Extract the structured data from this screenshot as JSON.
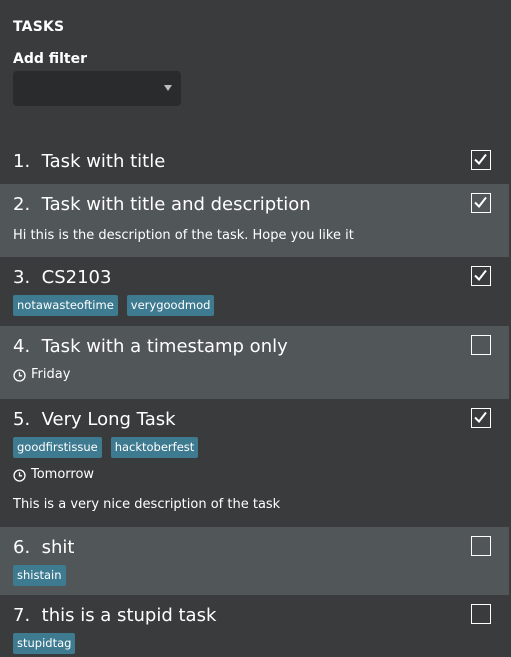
{
  "header": {
    "title": "TASKS",
    "filter_label": "Add filter",
    "filter_value": ""
  },
  "tasks": [
    {
      "index": "1.",
      "title": "Task with title",
      "checked": true,
      "tags": [],
      "time": "",
      "description": ""
    },
    {
      "index": "2.",
      "title": "Task with title and description",
      "checked": true,
      "tags": [],
      "time": "",
      "description": "Hi this is the description of the task. Hope you like it"
    },
    {
      "index": "3.",
      "title": "CS2103",
      "checked": true,
      "tags": [
        "notawasteoftime",
        "verygoodmod"
      ],
      "time": "",
      "description": ""
    },
    {
      "index": "4.",
      "title": "Task with a timestamp only",
      "checked": false,
      "tags": [],
      "time": "Friday",
      "description": ""
    },
    {
      "index": "5.",
      "title": "Very Long Task",
      "checked": true,
      "tags": [
        "goodfirstissue",
        "hacktoberfest"
      ],
      "time": "Tomorrow",
      "description": "This is a very nice description of the task"
    },
    {
      "index": "6.",
      "title": "shit",
      "checked": false,
      "tags": [
        "shistain"
      ],
      "time": "",
      "description": ""
    },
    {
      "index": "7.",
      "title": "this is a stupid task",
      "checked": false,
      "tags": [
        "stupidtag"
      ],
      "time": "",
      "description": ""
    }
  ],
  "colors": {
    "background": "#3a3b3d",
    "alt_row": "#515658",
    "tag": "#3e7b91"
  },
  "icons": {
    "dropdown": "chevron-down-icon",
    "time": "clock-icon",
    "check": "checkmark-icon"
  }
}
